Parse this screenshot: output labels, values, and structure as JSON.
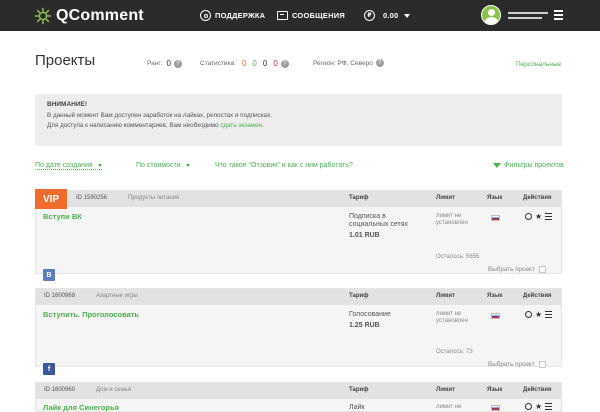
{
  "header": {
    "logo_text": "QComment",
    "nav_support": "ПОДДЕРЖКА",
    "nav_messages": "СООБЩЕНИЯ",
    "balance": "0.00",
    "menu_icon": "hamburger-icon"
  },
  "page": {
    "title": "Проекты",
    "rank_label": "Ранг:",
    "rank_value": "0",
    "stats_label": "Статистика:",
    "stats_values": [
      "0",
      "0",
      "0",
      "0"
    ],
    "stats_colors": [
      "#ef6c2d",
      "#4caf50",
      "#333333",
      "#d32f2f"
    ],
    "region_label": "Регион: РФ, Северо",
    "personal_link": "Персональные"
  },
  "notice": {
    "title": "ВНИМАНИЕ!",
    "line1": "В данный момент Вам доступен заработок на лайках, репостах и подписках.",
    "line2_prefix": "Для доступа к написанию комментариев, Вам необходимо ",
    "line2_link": "сдать экзамен",
    "line2_suffix": "."
  },
  "filters": {
    "sort_date": "По дате создания",
    "sort_type": "По стоимости",
    "faq": "Что такое \"Отзовик\" и как с ним работать?",
    "filter_projects": "Фильтры проектов"
  },
  "columns": {
    "tariff": "Тариф",
    "limit": "Лимит",
    "lang": "Язык",
    "actions": "Действия",
    "select": "Выбрать проект"
  },
  "cards": [
    {
      "vip": "VIP",
      "id": "ID 1590256",
      "category": "Продукты питания",
      "title": "Вступи ВК",
      "tariff_name": "Подписка в социальных сетях",
      "price": "1.01 RUB",
      "limit": "лимит не установлен",
      "remaining": "Осталось: 5655",
      "social": "В"
    },
    {
      "vip": "",
      "id": "ID 1600968",
      "category": "Азартные игры",
      "title": "Вступить. Проголосовать",
      "tariff_name": "Голосование",
      "price": "1.25 RUB",
      "limit": "лимит не установлен",
      "remaining": "Осталось: 73",
      "social": "f"
    },
    {
      "vip": "",
      "id": "ID 1600960",
      "category": "Дом и семья",
      "title": "Лайк для Синегорья",
      "tariff_name": "Лайк",
      "price": "",
      "limit": "лимит не",
      "remaining": "",
      "social": ""
    }
  ]
}
